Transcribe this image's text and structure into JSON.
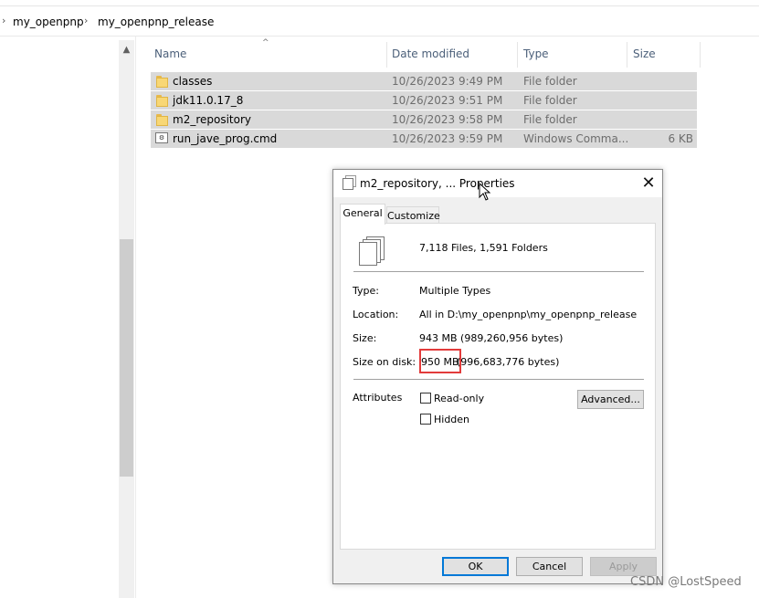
{
  "breadcrumb": {
    "items": [
      "my_openpnp",
      "my_openpnp_release"
    ]
  },
  "columns": {
    "name": "Name",
    "date_modified": "Date modified",
    "type": "Type",
    "size": "Size"
  },
  "files": [
    {
      "name": "classes",
      "date": "10/26/2023 9:49 PM",
      "type": "File folder",
      "size": "",
      "icon": "folder-icon"
    },
    {
      "name": "jdk11.0.17_8",
      "date": "10/26/2023 9:51 PM",
      "type": "File folder",
      "size": "",
      "icon": "folder-icon"
    },
    {
      "name": "m2_repository",
      "date": "10/26/2023 9:58 PM",
      "type": "File folder",
      "size": "",
      "icon": "folder-icon"
    },
    {
      "name": "run_jave_prog.cmd",
      "date": "10/26/2023 9:59 PM",
      "type": "Windows Comma...",
      "size": "6 KB",
      "icon": "cmd-file-icon"
    }
  ],
  "dialog": {
    "title": "m2_repository, ... Properties",
    "close_glyph": "✕",
    "tabs": [
      "General",
      "Customize"
    ],
    "summary": "7,118 Files, 1,591 Folders",
    "type_label": "Type:",
    "type_value": "Multiple Types",
    "location_label": "Location:",
    "location_value": "All in D:\\my_openpnp\\my_openpnp_release",
    "size_label": "Size:",
    "size_value": "943 MB (989,260,956 bytes)",
    "size_on_disk_label": "Size on disk:",
    "size_on_disk_mb": "950 MB",
    "size_on_disk_bytes": "(996,683,776 bytes)",
    "attributes_label": "Attributes",
    "readonly_label": "Read-only",
    "hidden_label": "Hidden",
    "advanced_label": "Advanced...",
    "ok_label": "OK",
    "cancel_label": "Cancel",
    "apply_label": "Apply"
  },
  "watermark": "CSDN @LostSpeed",
  "colors": {
    "selection": "#d9d9d9",
    "highlight_box": "#e23b3b",
    "ok_border": "#0078d7"
  }
}
